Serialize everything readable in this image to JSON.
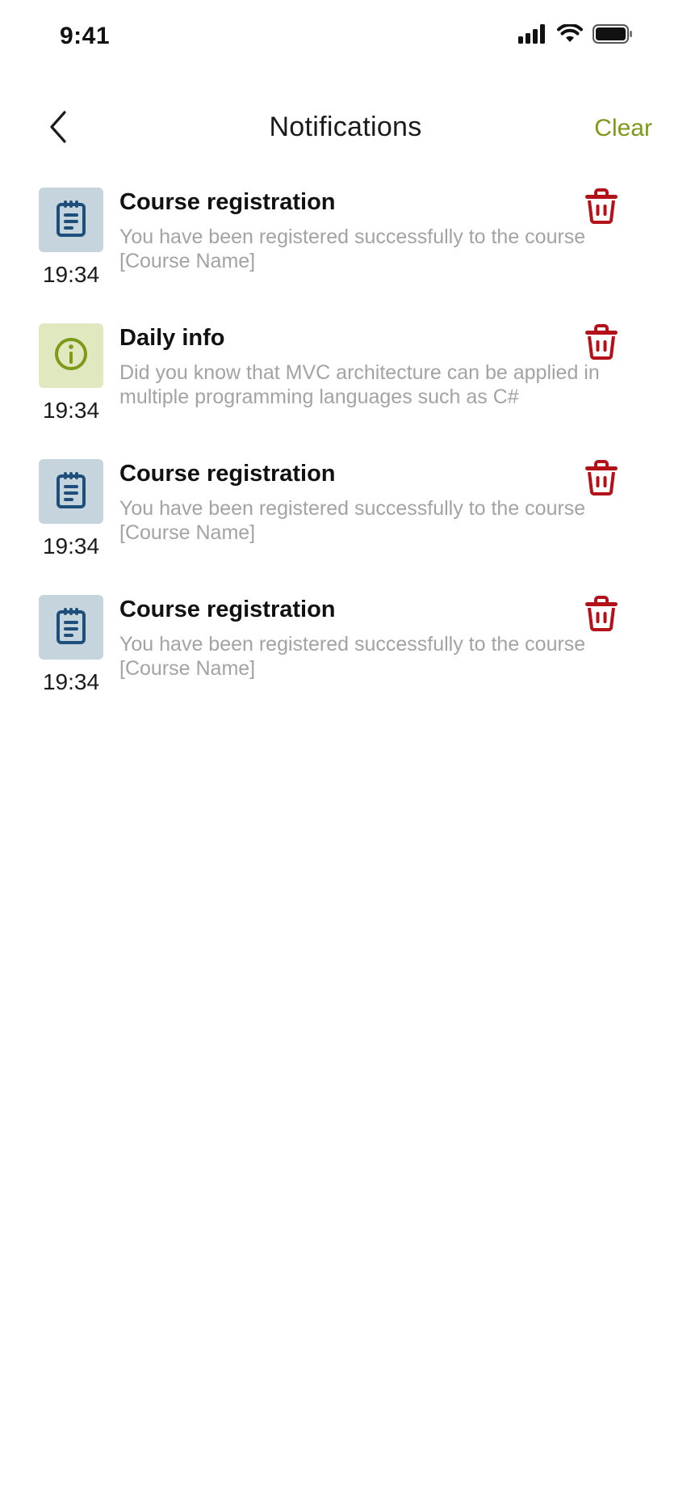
{
  "status_bar": {
    "time": "9:41",
    "icons": [
      "cellular-signal-icon",
      "wifi-icon",
      "battery-icon"
    ]
  },
  "header": {
    "back_icon": "chevron-left-icon",
    "title": "Notifications",
    "clear_label": "Clear"
  },
  "colors": {
    "accent": "#7c9a17",
    "delete": "#b3121b",
    "course_icon_bg": "#c6d4de",
    "course_icon": "#1d4f7a",
    "info_icon_bg": "#e0e8bf",
    "info_icon": "#7c9a17",
    "body_text": "#a3a3a3"
  },
  "notifications": [
    {
      "type": "course",
      "icon": "clipboard-icon",
      "time": "19:34",
      "title": "Course registration",
      "body": "You have been registered successfully to the course [Course Name]"
    },
    {
      "type": "info",
      "icon": "info-icon",
      "time": "19:34",
      "title": "Daily info",
      "body": "Did you know that MVC architecture can be applied in multiple programming languages such as C#"
    },
    {
      "type": "course",
      "icon": "clipboard-icon",
      "time": "19:34",
      "title": "Course registration",
      "body": "You have been registered successfully to the course [Course Name]"
    },
    {
      "type": "course",
      "icon": "clipboard-icon",
      "time": "19:34",
      "title": "Course registration",
      "body": "You have been registered successfully to the course [Course Name]"
    }
  ]
}
